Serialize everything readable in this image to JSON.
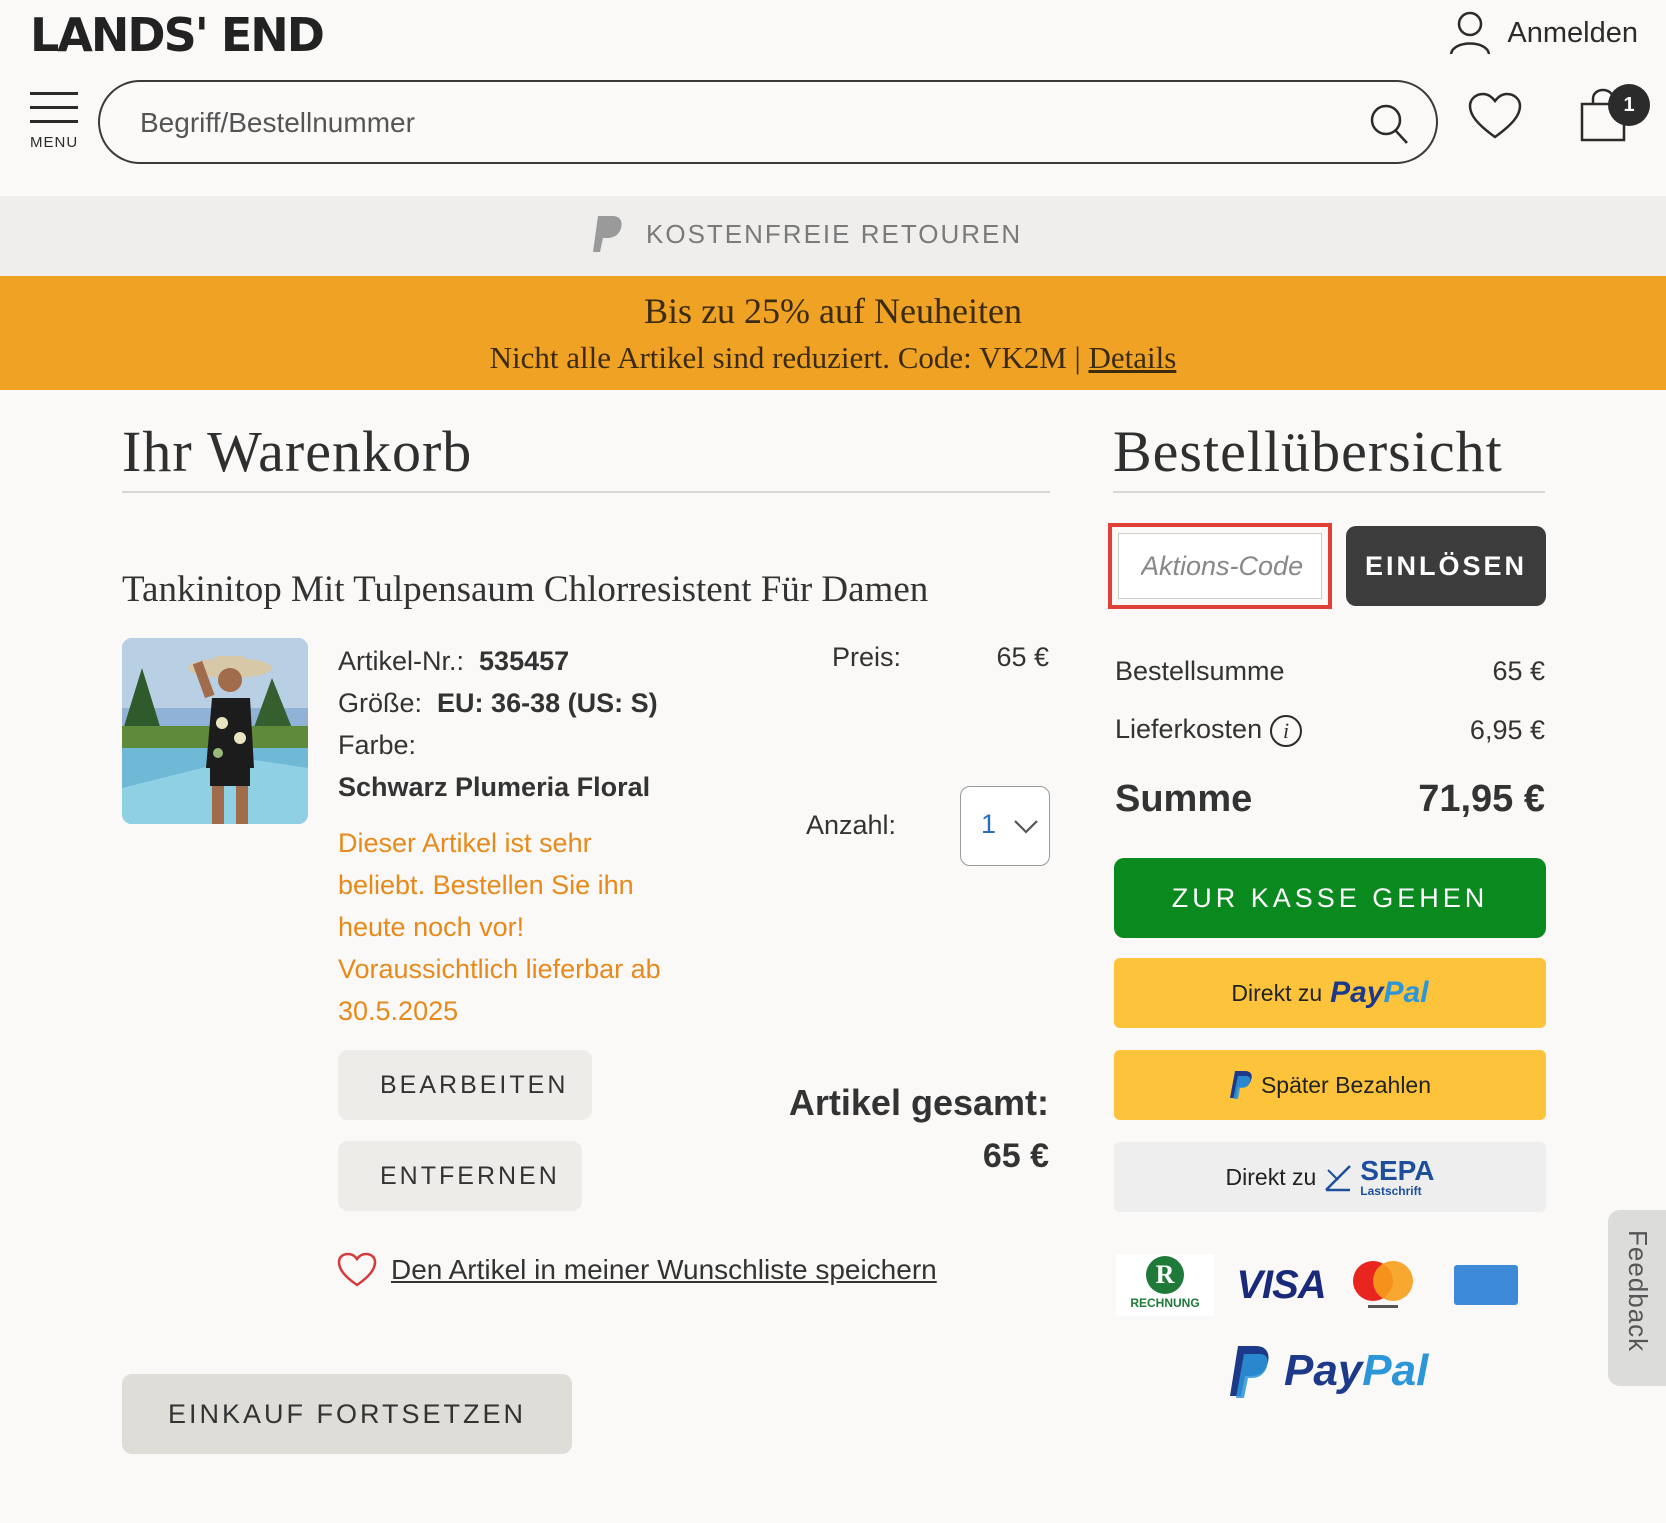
{
  "header": {
    "logo": "LANDS' END",
    "login_label": "Anmelden",
    "menu_label": "MENU",
    "search_placeholder": "Begriff/Bestellnummer",
    "cart_count": "1"
  },
  "banners": {
    "rotating_text": "KOSTENFREIE RETOUREN",
    "promo_line1": "Bis zu 25% auf Neuheiten",
    "promo_line2": "Nicht alle Artikel sind reduziert. Code: VK2M |",
    "promo_link": "Details",
    "promo_color": "#efa224"
  },
  "cart": {
    "title": "Ihr Warenkorb",
    "item": {
      "name": "Tankinitop Mit Tulpensaum Chlorresistent Für Damen",
      "article_label": "Artikel-Nr.:",
      "article_no": "535457",
      "size_label": "Größe:",
      "size": "EU: 36-38 (US: S)",
      "color_label": "Farbe:",
      "color": "Schwarz Plumeria Floral",
      "stock_note": "Dieser Artikel ist sehr beliebt. Bestellen Sie ihn heute noch vor! Voraussichtlich lieferbar ab 30.5.2025",
      "price_label": "Preis:",
      "price": "65 €",
      "qty_label": "Anzahl:",
      "qty": "1",
      "edit_label": "BEARBEITEN",
      "remove_label": "ENTFERNEN",
      "total_label": "Artikel gesamt:",
      "total": "65 €",
      "wishlist_label": "Den Artikel in meiner Wunschliste speichern"
    },
    "continue_label": "EINKAUF FORTSETZEN"
  },
  "summary": {
    "title": "Bestellübersicht",
    "promo_placeholder": "Aktions-Code",
    "redeem_label": "EINLÖSEN",
    "subtotal_label": "Bestellsumme",
    "subtotal": "65 €",
    "shipping_label": "Lieferkosten",
    "shipping": "6,95 €",
    "total_label": "Summe",
    "total": "71,95 €",
    "checkout_label": "ZUR KASSE GEHEN",
    "paypal_prefix": "Direkt zu",
    "paypal_pay": "Pay",
    "paypal_pal": "Pal",
    "later_label": "Später Bezahlen",
    "sepa_prefix": "Direkt zu",
    "sepa_title": "SEPA",
    "sepa_sub": "Lastschrift",
    "logos": {
      "rechnung_letter": "R",
      "rechnung": "RECHNUNG",
      "visa": "VISA"
    },
    "checkout_color": "#0a8a1e",
    "paypal_button_color": "#fdc33a"
  },
  "feedback_label": "Feedback"
}
